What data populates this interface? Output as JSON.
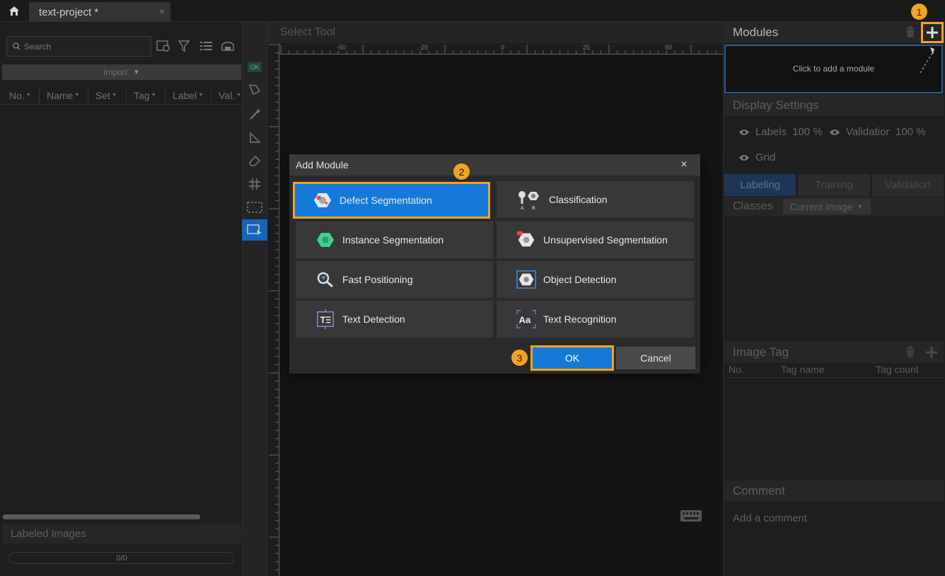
{
  "tab": {
    "title": "text-project *",
    "close": "×"
  },
  "left": {
    "search_placeholder": "Search",
    "import_label": "Import",
    "columns": [
      "No.",
      "Name",
      "Set",
      "Tag",
      "Label",
      "Val."
    ],
    "labeled_images_label": "Labeled Images",
    "progress_text": "0/0"
  },
  "tools": {
    "ok_chip": "OK"
  },
  "canvas": {
    "header": "Select Tool",
    "ruler_top": [
      "-50",
      "-25",
      "0",
      "25",
      "50"
    ]
  },
  "right": {
    "modules_title": "Modules",
    "module_hint": "Click to add a module",
    "display_settings": "Display Settings",
    "labels_label": "Labels",
    "labels_pct": "100 %",
    "validation_label": "Validation",
    "validation_pct": "100 %",
    "grid_label": "Grid",
    "tabs": [
      "Labeling",
      "Training",
      "Validation"
    ],
    "classes_label": "Classes",
    "current_image": "Current image",
    "image_tag": "Image Tag",
    "tag_columns": [
      "No.",
      "Tag name",
      "Tag count"
    ],
    "comment": "Comment",
    "comment_placeholder": "Add a comment"
  },
  "dialog": {
    "title": "Add Module",
    "close": "×",
    "options": [
      {
        "label": "Defect Segmentation",
        "icon": "defect-segmentation-icon",
        "selected": true
      },
      {
        "label": "Classification",
        "icon": "classification-icon"
      },
      {
        "label": "Instance Segmentation",
        "icon": "instance-segmentation-icon"
      },
      {
        "label": "Unsupervised Segmentation",
        "icon": "unsupervised-segmentation-icon"
      },
      {
        "label": "Fast Positioning",
        "icon": "fast-positioning-icon"
      },
      {
        "label": "Object Detection",
        "icon": "object-detection-icon"
      },
      {
        "label": "Text Detection",
        "icon": "text-detection-icon"
      },
      {
        "label": "Text Recognition",
        "icon": "text-recognition-icon"
      }
    ],
    "classification_sub": [
      "A",
      "B"
    ],
    "text_detection_glyph": "T",
    "text_recognition_glyph": "Aa",
    "ok": "OK",
    "cancel": "Cancel"
  },
  "badges": {
    "one": "1",
    "two": "2",
    "three": "3"
  },
  "colors": {
    "accent": "#1579d8",
    "highlight": "#f2a324",
    "background": "#1c1c1c"
  }
}
